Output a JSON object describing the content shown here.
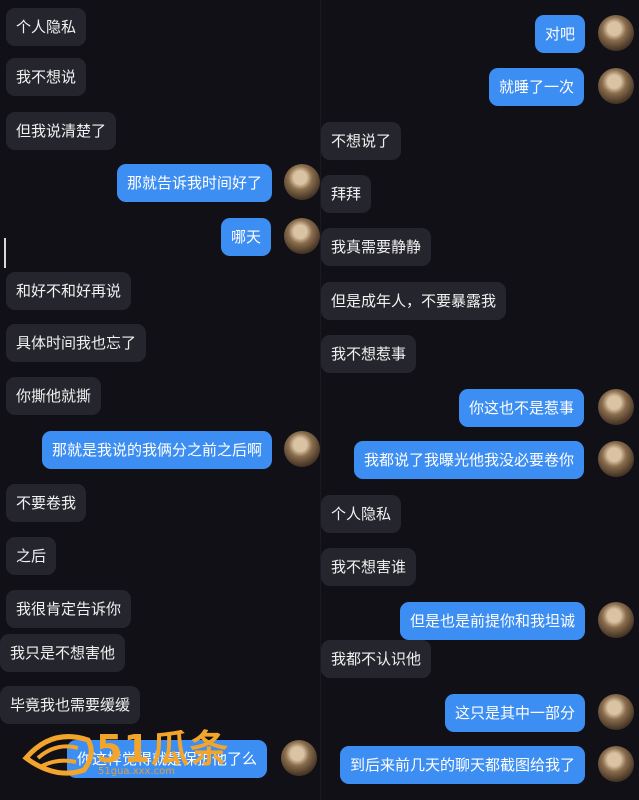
{
  "left": {
    "messages": [
      {
        "side": "recv",
        "text": "个人隐私"
      },
      {
        "side": "recv",
        "text": "我不想说"
      },
      {
        "side": "recv",
        "text": "但我说清楚了"
      },
      {
        "side": "sent",
        "text": "那就告诉我时间好了"
      },
      {
        "side": "sent",
        "text": "哪天"
      },
      {
        "side": "recv",
        "text": "和好不和好再说"
      },
      {
        "side": "recv",
        "text": "具体时间我也忘了"
      },
      {
        "side": "recv",
        "text": "你撕他就撕"
      },
      {
        "side": "sent",
        "text": "那就是我说的我俩分之前之后啊"
      },
      {
        "side": "recv",
        "text": "不要卷我"
      },
      {
        "side": "recv",
        "text": "之后"
      },
      {
        "side": "recv",
        "text": "我很肯定告诉你"
      },
      {
        "side": "recv",
        "text": "我只是不想害他"
      },
      {
        "side": "recv",
        "text": "毕竟我也需要缓缓"
      },
      {
        "side": "sent",
        "text": "你这样觉得就是保护他了么"
      }
    ]
  },
  "right": {
    "messages": [
      {
        "side": "sent",
        "text": "对吧"
      },
      {
        "side": "sent",
        "text": "就睡了一次"
      },
      {
        "side": "recv",
        "text": "不想说了"
      },
      {
        "side": "recv",
        "text": "拜拜"
      },
      {
        "side": "recv",
        "text": "我真需要静静"
      },
      {
        "side": "recv",
        "text": "但是成年人，不要暴露我"
      },
      {
        "side": "recv",
        "text": "我不想惹事"
      },
      {
        "side": "sent",
        "text": "你这也不是惹事"
      },
      {
        "side": "sent",
        "text": "我都说了我曝光他我没必要卷你"
      },
      {
        "side": "recv",
        "text": "个人隐私"
      },
      {
        "side": "recv",
        "text": "我不想害谁"
      },
      {
        "side": "sent",
        "text": "但是也是前提你和我坦诚"
      },
      {
        "side": "recv",
        "text": "我都不认识他"
      },
      {
        "side": "sent",
        "text": "这只是其中一部分"
      },
      {
        "side": "sent",
        "text": "到后来前几天的聊天都截图给我了"
      }
    ]
  },
  "watermark": {
    "text": "51瓜条",
    "url": "51gua.xxx.com"
  },
  "colors": {
    "sent": "#3d8ef2",
    "recv": "#25252d",
    "bg": "#101016",
    "watermark": "#f2a52a"
  }
}
